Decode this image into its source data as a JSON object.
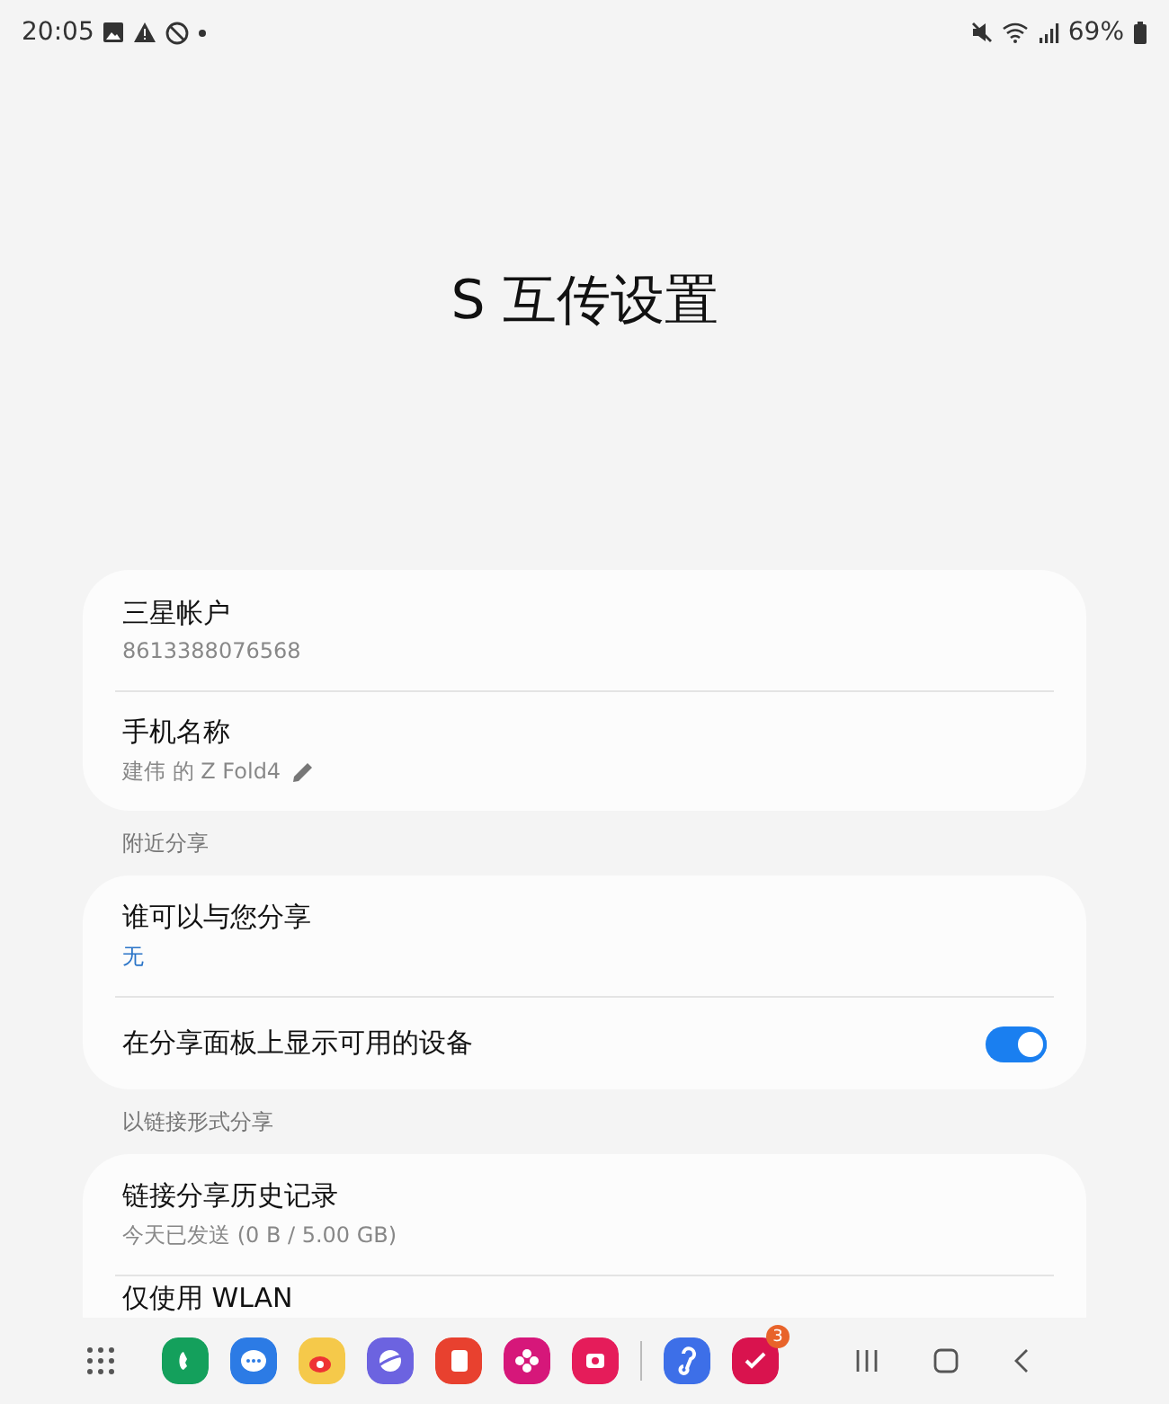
{
  "status_bar": {
    "time": "20:05",
    "battery": "69%"
  },
  "title": "S 互传设置",
  "groups": [
    {
      "items": [
        {
          "kind": "text",
          "title": "三星帐户",
          "summary": "8613388076568",
          "summary_highlighted": false,
          "editable": false
        },
        {
          "kind": "text",
          "title": "手机名称",
          "summary": "建伟 的 Z Fold4",
          "summary_highlighted": false,
          "editable": true
        }
      ]
    },
    {
      "header": "附近分享",
      "items": [
        {
          "kind": "text",
          "title": "谁可以与您分享",
          "summary": "无",
          "summary_highlighted": true,
          "editable": false
        },
        {
          "kind": "switch",
          "title": "在分享面板上显示可用的设备",
          "on": true
        }
      ]
    },
    {
      "header": "以链接形式分享",
      "items": [
        {
          "kind": "text",
          "title": "链接分享历史记录",
          "summary": "今天已发送 (0 B / 5.00 GB)",
          "summary_highlighted": false,
          "editable": false
        },
        {
          "kind": "text",
          "title": "仅使用 WLAN"
        }
      ]
    }
  ],
  "taskbar": {
    "apps": [
      {
        "color": "#14a05c"
      },
      {
        "color": "#2c7be5"
      },
      {
        "color": "#f5c94a"
      },
      {
        "color": "#6c63e0"
      },
      {
        "color": "#e8412f"
      },
      {
        "color": "#d6177a"
      },
      {
        "color": "#e51c5a"
      },
      {
        "color": "#3d6fe8"
      },
      {
        "color": "#d9134e",
        "badge": "3"
      }
    ]
  }
}
